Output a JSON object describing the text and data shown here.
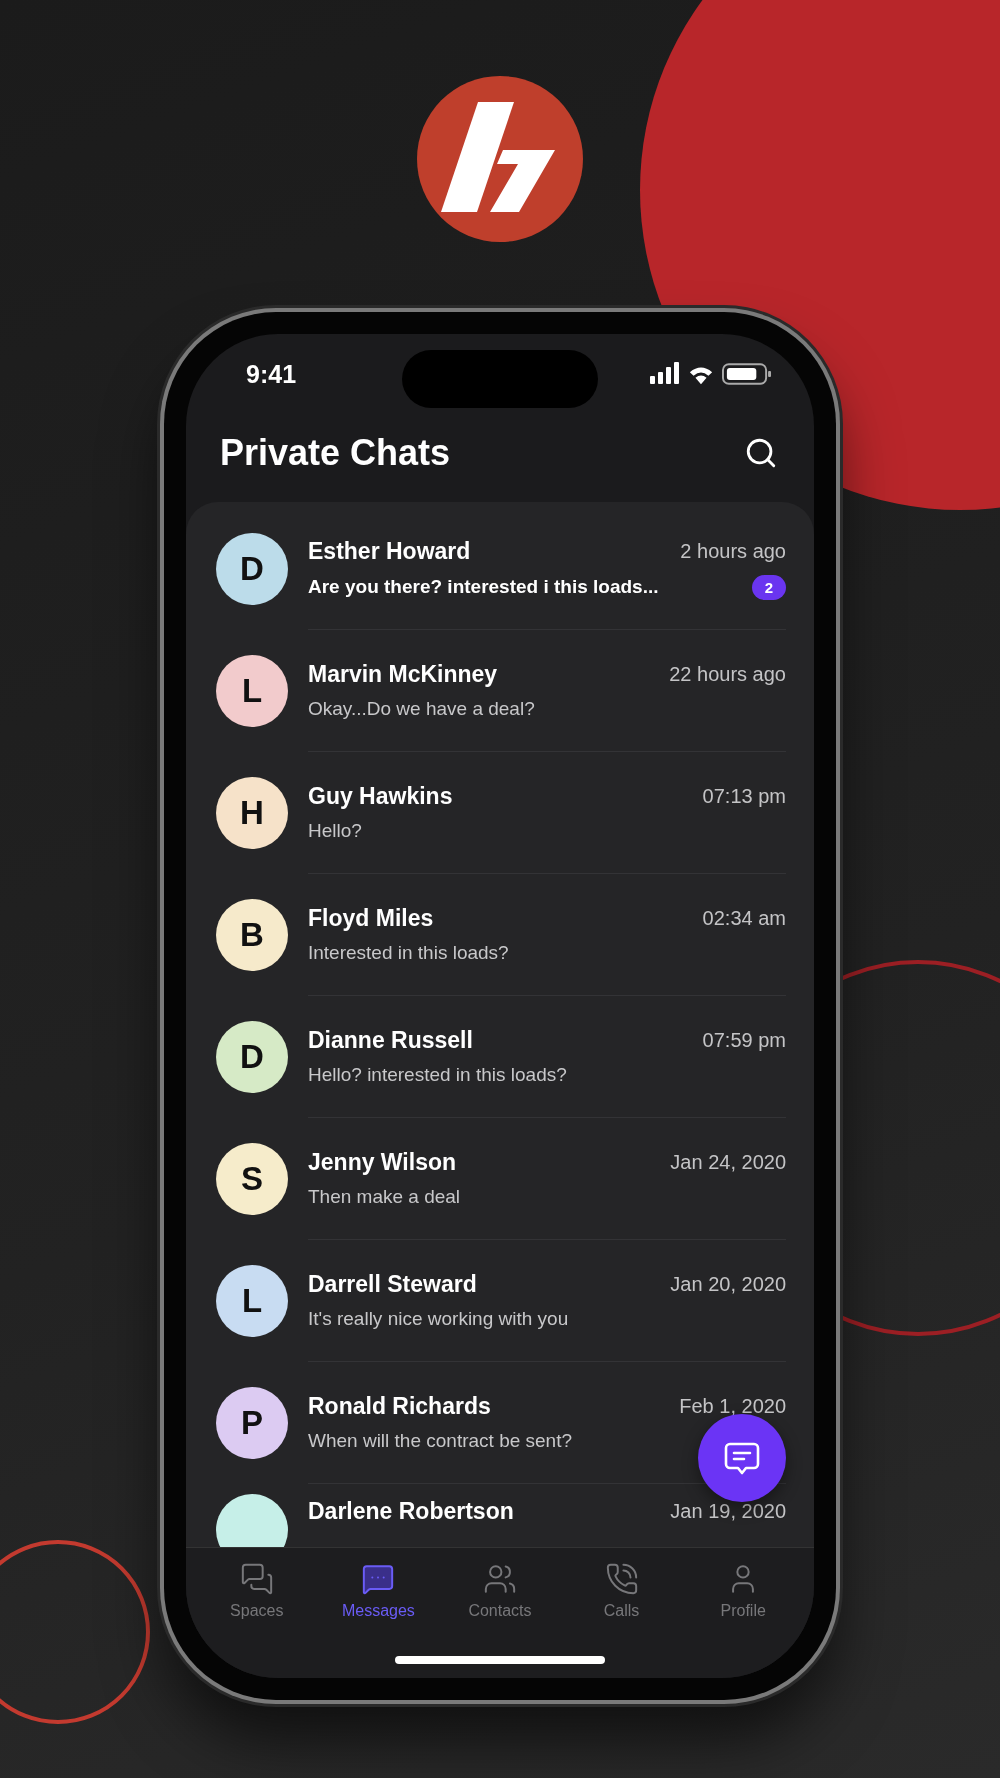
{
  "status_bar": {
    "time": "9:41"
  },
  "header": {
    "title": "Private Chats"
  },
  "chats": [
    {
      "avatar_letter": "D",
      "color": "#bcdcea",
      "name": "Esther Howard",
      "time": "2 hours ago",
      "message": "Are you there?  interested i this loads...",
      "unread": true,
      "badge": "2"
    },
    {
      "avatar_letter": "L",
      "color": "#f2cbcc",
      "name": "Marvin McKinney",
      "time": "22 hours ago",
      "message": "Okay...Do we have a deal?",
      "unread": false
    },
    {
      "avatar_letter": "H",
      "color": "#f6e2c9",
      "name": "Guy Hawkins",
      "time": "07:13 pm",
      "message": "Hello?",
      "unread": false
    },
    {
      "avatar_letter": "B",
      "color": "#f6eacb",
      "name": "Floyd Miles",
      "time": "02:34 am",
      "message": "Interested in this loads?",
      "unread": false
    },
    {
      "avatar_letter": "D",
      "color": "#d6eac6",
      "name": "Dianne Russell",
      "time": "07:59 pm",
      "message": "Hello? interested in this loads?",
      "unread": false
    },
    {
      "avatar_letter": "S",
      "color": "#f6eccb",
      "name": "Jenny Wilson",
      "time": "Jan 24, 2020",
      "message": "Then make a deal",
      "unread": false
    },
    {
      "avatar_letter": "L",
      "color": "#c8dcf2",
      "name": "Darrell Steward",
      "time": "Jan 20, 2020",
      "message": "It's really nice working with you",
      "unread": false
    },
    {
      "avatar_letter": "P",
      "color": "#dccbf2",
      "name": "Ronald Richards",
      "time": "Feb 1, 2020",
      "message": "When will the contract be sent?",
      "unread": false
    },
    {
      "color": "#c6efe8",
      "name": "Darlene Robertson",
      "time": "Jan 19, 2020"
    }
  ],
  "tab_bar": [
    {
      "kind": "spaces",
      "label": "Spaces",
      "selected": false
    },
    {
      "kind": "messages",
      "label": "Messages",
      "selected": true
    },
    {
      "kind": "contacts",
      "label": "Contacts",
      "selected": false
    },
    {
      "kind": "calls",
      "label": "Calls",
      "selected": false
    },
    {
      "kind": "profile",
      "label": "Profile",
      "selected": false
    }
  ]
}
